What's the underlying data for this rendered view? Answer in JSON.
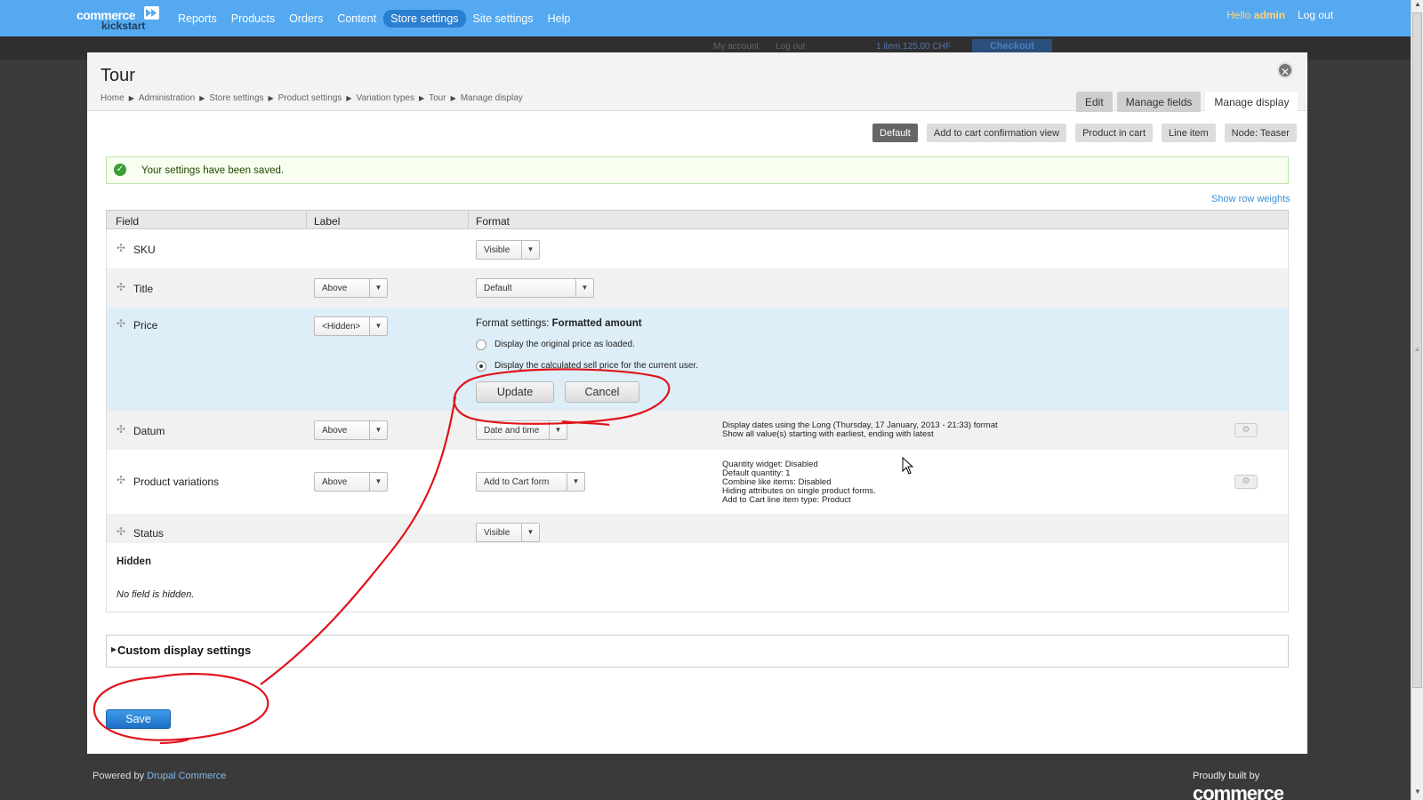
{
  "toolbar": {
    "logo_line1": "commerce",
    "logo_line2": "kickstart",
    "menu": [
      {
        "label": "Reports"
      },
      {
        "label": "Products"
      },
      {
        "label": "Orders"
      },
      {
        "label": "Content"
      },
      {
        "label": "Store settings",
        "active": true
      },
      {
        "label": "Site settings"
      },
      {
        "label": "Help"
      }
    ],
    "hello_prefix": "Hello",
    "hello_user": "admin",
    "logout": "Log out",
    "accent_color": "#55a9f0"
  },
  "background_site": {
    "my_account": "My account",
    "log_out": "Log out",
    "cart_text": "1 item 125.00 CHF",
    "checkout": "Checkout"
  },
  "overlay": {
    "title": "Tour",
    "close_icon": "close-icon",
    "breadcrumb": [
      "Home",
      "Administration",
      "Store settings",
      "Product settings",
      "Variation types",
      "Tour",
      "Manage display"
    ],
    "tabs": [
      {
        "label": "Edit"
      },
      {
        "label": "Manage fields"
      },
      {
        "label": "Manage display",
        "active": true
      }
    ],
    "view_modes": [
      {
        "label": "Default",
        "active": true
      },
      {
        "label": "Add to cart confirmation view"
      },
      {
        "label": "Product in cart"
      },
      {
        "label": "Line item"
      },
      {
        "label": "Node: Teaser"
      }
    ],
    "status_message": "Your settings have been saved.",
    "show_row_weights": "Show row weights",
    "table": {
      "headers": {
        "field": "Field",
        "label": "Label",
        "format": "Format"
      },
      "rows": {
        "sku": {
          "field": "SKU",
          "format": "Visible"
        },
        "title": {
          "field": "Title",
          "label": "Above",
          "format": "Default"
        },
        "price": {
          "field": "Price",
          "label": "<Hidden>",
          "format_settings_prefix": "Format settings:",
          "format_settings_name": "Formatted amount",
          "option1": "Display the original price as loaded.",
          "option2": "Display the calculated sell price for the current user.",
          "selected_option": 2,
          "update": "Update",
          "cancel": "Cancel"
        },
        "datum": {
          "field": "Datum",
          "label": "Above",
          "format": "Date and time",
          "summary1": "Display dates using the Long (Thursday, 17 January, 2013 - 21:33) format",
          "summary2": "Show all value(s) starting with earliest, ending with latest"
        },
        "variations": {
          "field": "Product variations",
          "label": "Above",
          "format": "Add to Cart form",
          "summary": [
            "Quantity widget: Disabled",
            "Default quantity: 1",
            "Combine like items: Disabled",
            "Hiding attributes on single product forms.",
            "Add to Cart line item type: Product"
          ]
        },
        "status": {
          "field": "Status",
          "format": "Visible"
        }
      },
      "hidden_title": "Hidden",
      "hidden_note": "No field is hidden."
    },
    "custom_display_settings": "Custom display settings",
    "save": "Save"
  },
  "footer": {
    "powered_prefix": "Powered by",
    "powered_link": "Drupal Commerce",
    "proudly": "Proudly built by",
    "logo_text": "commerce"
  },
  "annotation_color": "#e0141b"
}
